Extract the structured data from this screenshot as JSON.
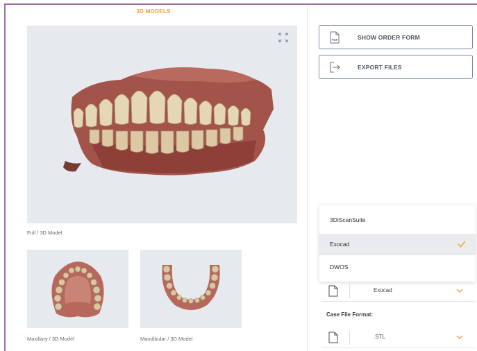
{
  "section_title": "3D MODELS",
  "main_view": {
    "caption": "Full / 3D Model"
  },
  "thumbnails": [
    {
      "caption": "Maxillary / 3D Model"
    },
    {
      "caption": "Mandibular / 3D Model"
    }
  ],
  "actions": {
    "order_form_label": "SHOW ORDER FORM",
    "pdf_icon_text": "PDF",
    "export_label": "EXPORT FILES"
  },
  "software_dropdown": {
    "options": [
      "3DiScanSuite",
      "Exocad",
      "DWOS"
    ],
    "selected": "Exocad",
    "current_value": "Exocad"
  },
  "case_file_format": {
    "label": "Case File Format:",
    "value": ".STL"
  },
  "colors": {
    "accent": "#f0a13a",
    "frame": "#9b6f9e",
    "button_border": "#7d8aa6"
  }
}
